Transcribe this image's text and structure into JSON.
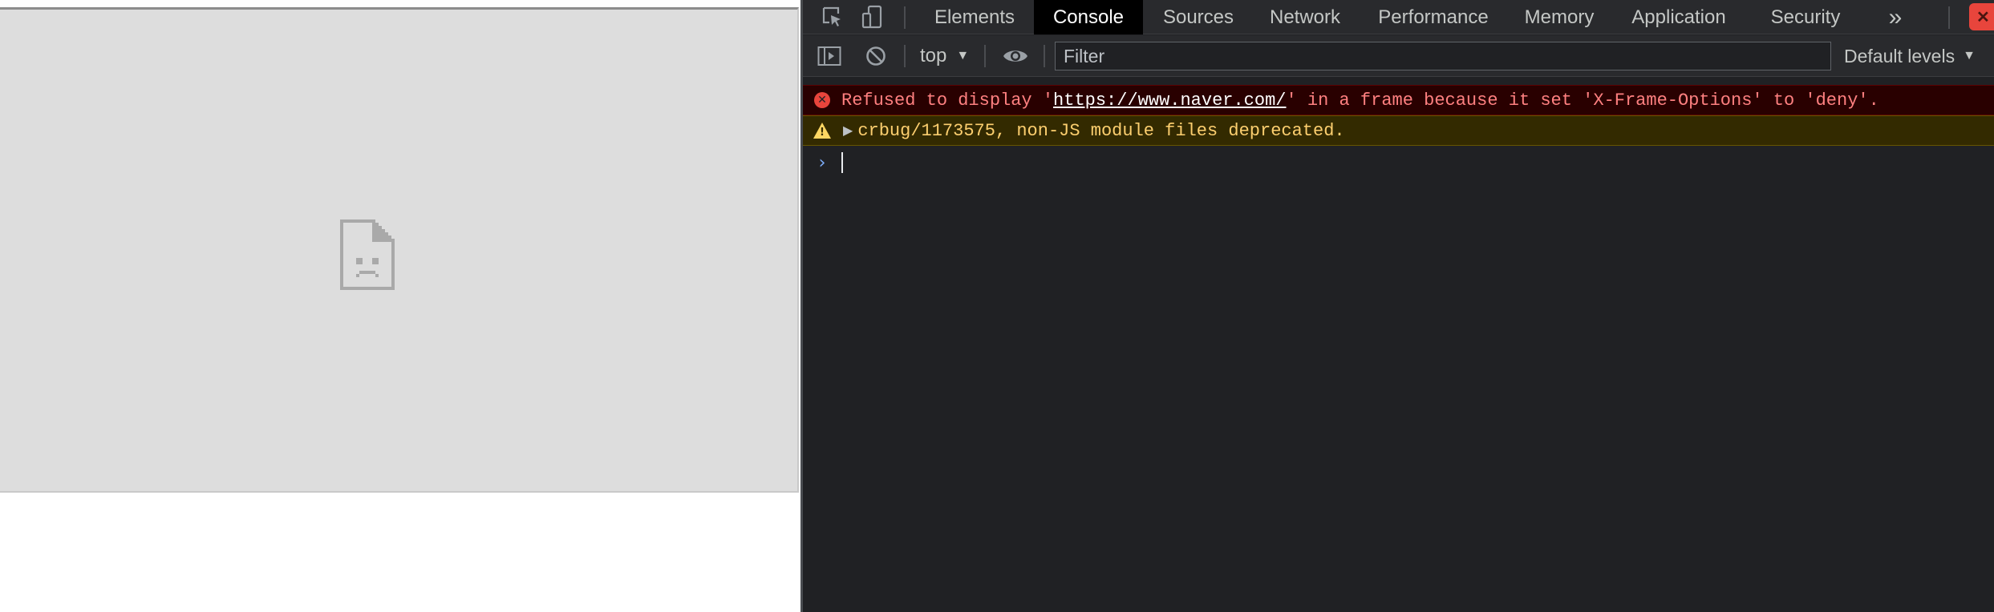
{
  "page": {
    "frame_error_icon": "sad-document-icon"
  },
  "devtools": {
    "toolbar_icons": [
      "inspect-element-icon",
      "device-toolbar-icon"
    ],
    "tabs": [
      "Elements",
      "Console",
      "Sources",
      "Network",
      "Performance",
      "Memory",
      "Application",
      "Security"
    ],
    "active_tab": "Console",
    "more_tabs": "»",
    "error_badge": "✕",
    "console_toolbar": {
      "context": "top",
      "filter_placeholder": "Filter",
      "levels": "Default levels"
    },
    "messages": {
      "error": {
        "prefix": "Refused to display '",
        "link": "https://www.naver.com/",
        "suffix": "' in a frame because it set 'X-Frame-Options' to 'deny'."
      },
      "warning": {
        "text": "crbug/1173575, non-JS module files deprecated."
      }
    },
    "prompt_symbol": "›",
    "colors": {
      "error_text": "#ff8080",
      "error_bg": "#290000",
      "warning_text": "#fdcf6f",
      "warning_bg": "#332a00",
      "panel_bg": "#202124",
      "prompt": "#7cacf8"
    }
  }
}
